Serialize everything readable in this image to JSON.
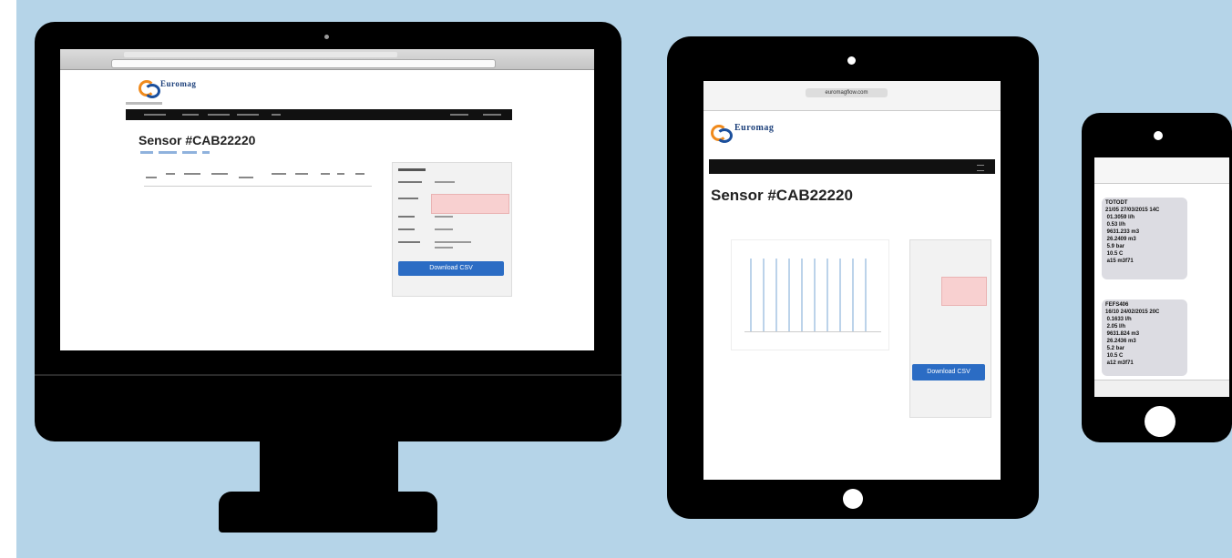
{
  "brand": {
    "name": "Euromag"
  },
  "desktop": {
    "sensor_title": "Sensor #CAB22220",
    "download_label": "Download CSV"
  },
  "tablet": {
    "url_text": "euromagflow.com",
    "sensor_title": "Sensor #CAB22220",
    "download_label": "Download CSV"
  },
  "phone": {
    "messages": [
      "TOTODT\n21/05 27/03/2015 14C\n 01.3059 l/h\n 0.53 l/h\n 9631.233 m3\n 26.2409 m3\n 5.9 bar\n 10.5 C\n a15 m3f71",
      "FEFS406\n16/10 24/02/2015 20C\n 0.1633 l/h\n 2.05 l/h\n 9631.824 m3\n 26.2436 m3\n 5.2 bar\n 10.5 C\n a12 m3f71"
    ]
  },
  "colors": {
    "background": "#b5d4e8",
    "device": "#000000",
    "accent": "#2b6cc4",
    "brand_orange": "#f08a1c",
    "brand_blue": "#1b4f9c"
  }
}
